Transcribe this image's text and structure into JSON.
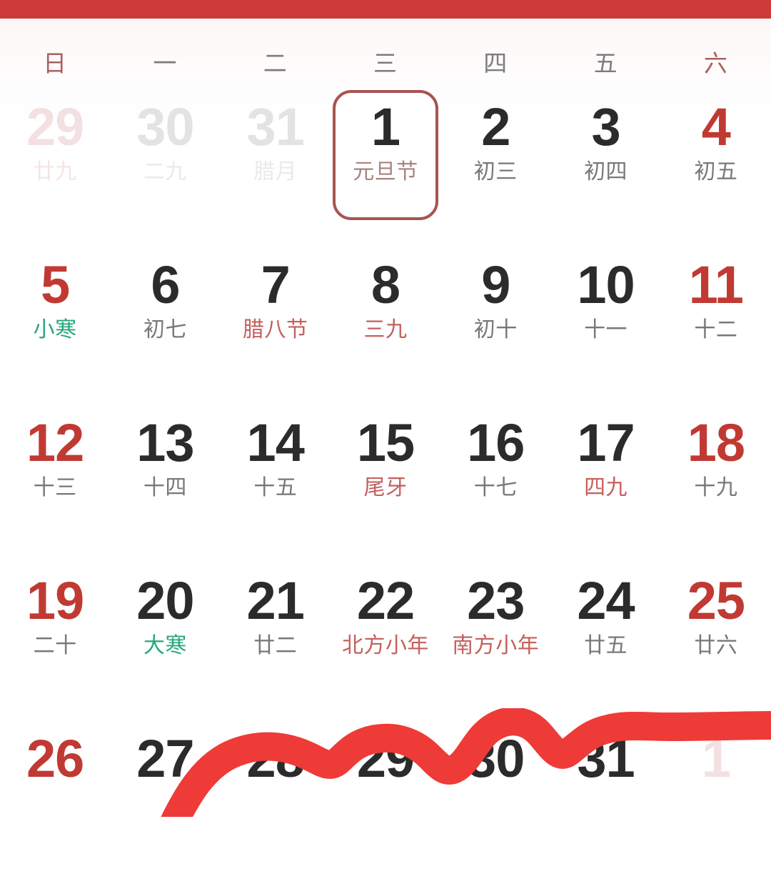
{
  "banner": {
    "color": "#cc3b38"
  },
  "accent": {
    "red": "#c03a33",
    "muted_red": "#a85450",
    "green": "#27a57e",
    "grey": "#787878",
    "stroke_red": "#ee3b38"
  },
  "weekdays": [
    {
      "label": "日",
      "type": "weekend"
    },
    {
      "label": "一",
      "type": "weekday"
    },
    {
      "label": "二",
      "type": "weekday"
    },
    {
      "label": "三",
      "type": "weekday"
    },
    {
      "label": "四",
      "type": "weekday"
    },
    {
      "label": "五",
      "type": "weekday"
    },
    {
      "label": "六",
      "type": "weekend"
    }
  ],
  "weeks": [
    [
      {
        "num": "29",
        "sub": "廿九",
        "num_style": "num-fadered",
        "sub_style": "sub-fadered",
        "selected": false,
        "outside": true
      },
      {
        "num": "30",
        "sub": "二九",
        "num_style": "num-fade",
        "sub_style": "sub-fade",
        "selected": false,
        "outside": true
      },
      {
        "num": "31",
        "sub": "腊月",
        "num_style": "num-fade",
        "sub_style": "sub-fade",
        "selected": false,
        "outside": true
      },
      {
        "num": "1",
        "sub": "元旦节",
        "num_style": "num-dark",
        "sub_style": "sub-mauve",
        "selected": true,
        "outside": false
      },
      {
        "num": "2",
        "sub": "初三",
        "num_style": "num-dark",
        "sub_style": "sub-grey",
        "selected": false,
        "outside": false
      },
      {
        "num": "3",
        "sub": "初四",
        "num_style": "num-dark",
        "sub_style": "sub-grey",
        "selected": false,
        "outside": false
      },
      {
        "num": "4",
        "sub": "初五",
        "num_style": "num-red",
        "sub_style": "sub-grey",
        "selected": false,
        "outside": false
      }
    ],
    [
      {
        "num": "5",
        "sub": "小寒",
        "num_style": "num-red",
        "sub_style": "sub-green",
        "selected": false,
        "outside": false
      },
      {
        "num": "6",
        "sub": "初七",
        "num_style": "num-dark",
        "sub_style": "sub-grey",
        "selected": false,
        "outside": false
      },
      {
        "num": "7",
        "sub": "腊八节",
        "num_style": "num-dark",
        "sub_style": "sub-red",
        "selected": false,
        "outside": false
      },
      {
        "num": "8",
        "sub": "三九",
        "num_style": "num-dark",
        "sub_style": "sub-red",
        "selected": false,
        "outside": false
      },
      {
        "num": "9",
        "sub": "初十",
        "num_style": "num-dark",
        "sub_style": "sub-grey",
        "selected": false,
        "outside": false
      },
      {
        "num": "10",
        "sub": "十一",
        "num_style": "num-dark",
        "sub_style": "sub-grey",
        "selected": false,
        "outside": false
      },
      {
        "num": "11",
        "sub": "十二",
        "num_style": "num-red",
        "sub_style": "sub-grey",
        "selected": false,
        "outside": false
      }
    ],
    [
      {
        "num": "12",
        "sub": "十三",
        "num_style": "num-red",
        "sub_style": "sub-grey",
        "selected": false,
        "outside": false
      },
      {
        "num": "13",
        "sub": "十四",
        "num_style": "num-dark",
        "sub_style": "sub-grey",
        "selected": false,
        "outside": false
      },
      {
        "num": "14",
        "sub": "十五",
        "num_style": "num-dark",
        "sub_style": "sub-grey",
        "selected": false,
        "outside": false
      },
      {
        "num": "15",
        "sub": "尾牙",
        "num_style": "num-dark",
        "sub_style": "sub-red",
        "selected": false,
        "outside": false
      },
      {
        "num": "16",
        "sub": "十七",
        "num_style": "num-dark",
        "sub_style": "sub-grey",
        "selected": false,
        "outside": false
      },
      {
        "num": "17",
        "sub": "四九",
        "num_style": "num-dark",
        "sub_style": "sub-red",
        "selected": false,
        "outside": false
      },
      {
        "num": "18",
        "sub": "十九",
        "num_style": "num-red",
        "sub_style": "sub-grey",
        "selected": false,
        "outside": false
      }
    ],
    [
      {
        "num": "19",
        "sub": "二十",
        "num_style": "num-red",
        "sub_style": "sub-grey",
        "selected": false,
        "outside": false
      },
      {
        "num": "20",
        "sub": "大寒",
        "num_style": "num-dark",
        "sub_style": "sub-green",
        "selected": false,
        "outside": false
      },
      {
        "num": "21",
        "sub": "廿二",
        "num_style": "num-dark",
        "sub_style": "sub-grey",
        "selected": false,
        "outside": false
      },
      {
        "num": "22",
        "sub": "北方小年",
        "num_style": "num-dark",
        "sub_style": "sub-red",
        "selected": false,
        "outside": false
      },
      {
        "num": "23",
        "sub": "南方小年",
        "num_style": "num-dark",
        "sub_style": "sub-red",
        "selected": false,
        "outside": false
      },
      {
        "num": "24",
        "sub": "廿五",
        "num_style": "num-dark",
        "sub_style": "sub-grey",
        "selected": false,
        "outside": false
      },
      {
        "num": "25",
        "sub": "廿六",
        "num_style": "num-red",
        "sub_style": "sub-grey",
        "selected": false,
        "outside": false
      }
    ],
    [
      {
        "num": "26",
        "sub": "",
        "num_style": "num-red",
        "sub_style": "sub-grey",
        "selected": false,
        "outside": false
      },
      {
        "num": "27",
        "sub": "",
        "num_style": "num-dark",
        "sub_style": "sub-grey",
        "selected": false,
        "outside": false
      },
      {
        "num": "28",
        "sub": "",
        "num_style": "num-dark",
        "sub_style": "sub-grey",
        "selected": false,
        "outside": false
      },
      {
        "num": "29",
        "sub": "",
        "num_style": "num-dark",
        "sub_style": "sub-grey",
        "selected": false,
        "outside": false
      },
      {
        "num": "30",
        "sub": "",
        "num_style": "num-dark",
        "sub_style": "sub-grey",
        "selected": false,
        "outside": false
      },
      {
        "num": "31",
        "sub": "",
        "num_style": "num-dark",
        "sub_style": "sub-grey",
        "selected": false,
        "outside": false
      },
      {
        "num": "1",
        "sub": "",
        "num_style": "num-fadered",
        "sub_style": "sub-fadered",
        "selected": false,
        "outside": true
      }
    ]
  ],
  "overlay": {
    "name": "red-wavy-brush-stroke",
    "color": "#ee3b38"
  }
}
